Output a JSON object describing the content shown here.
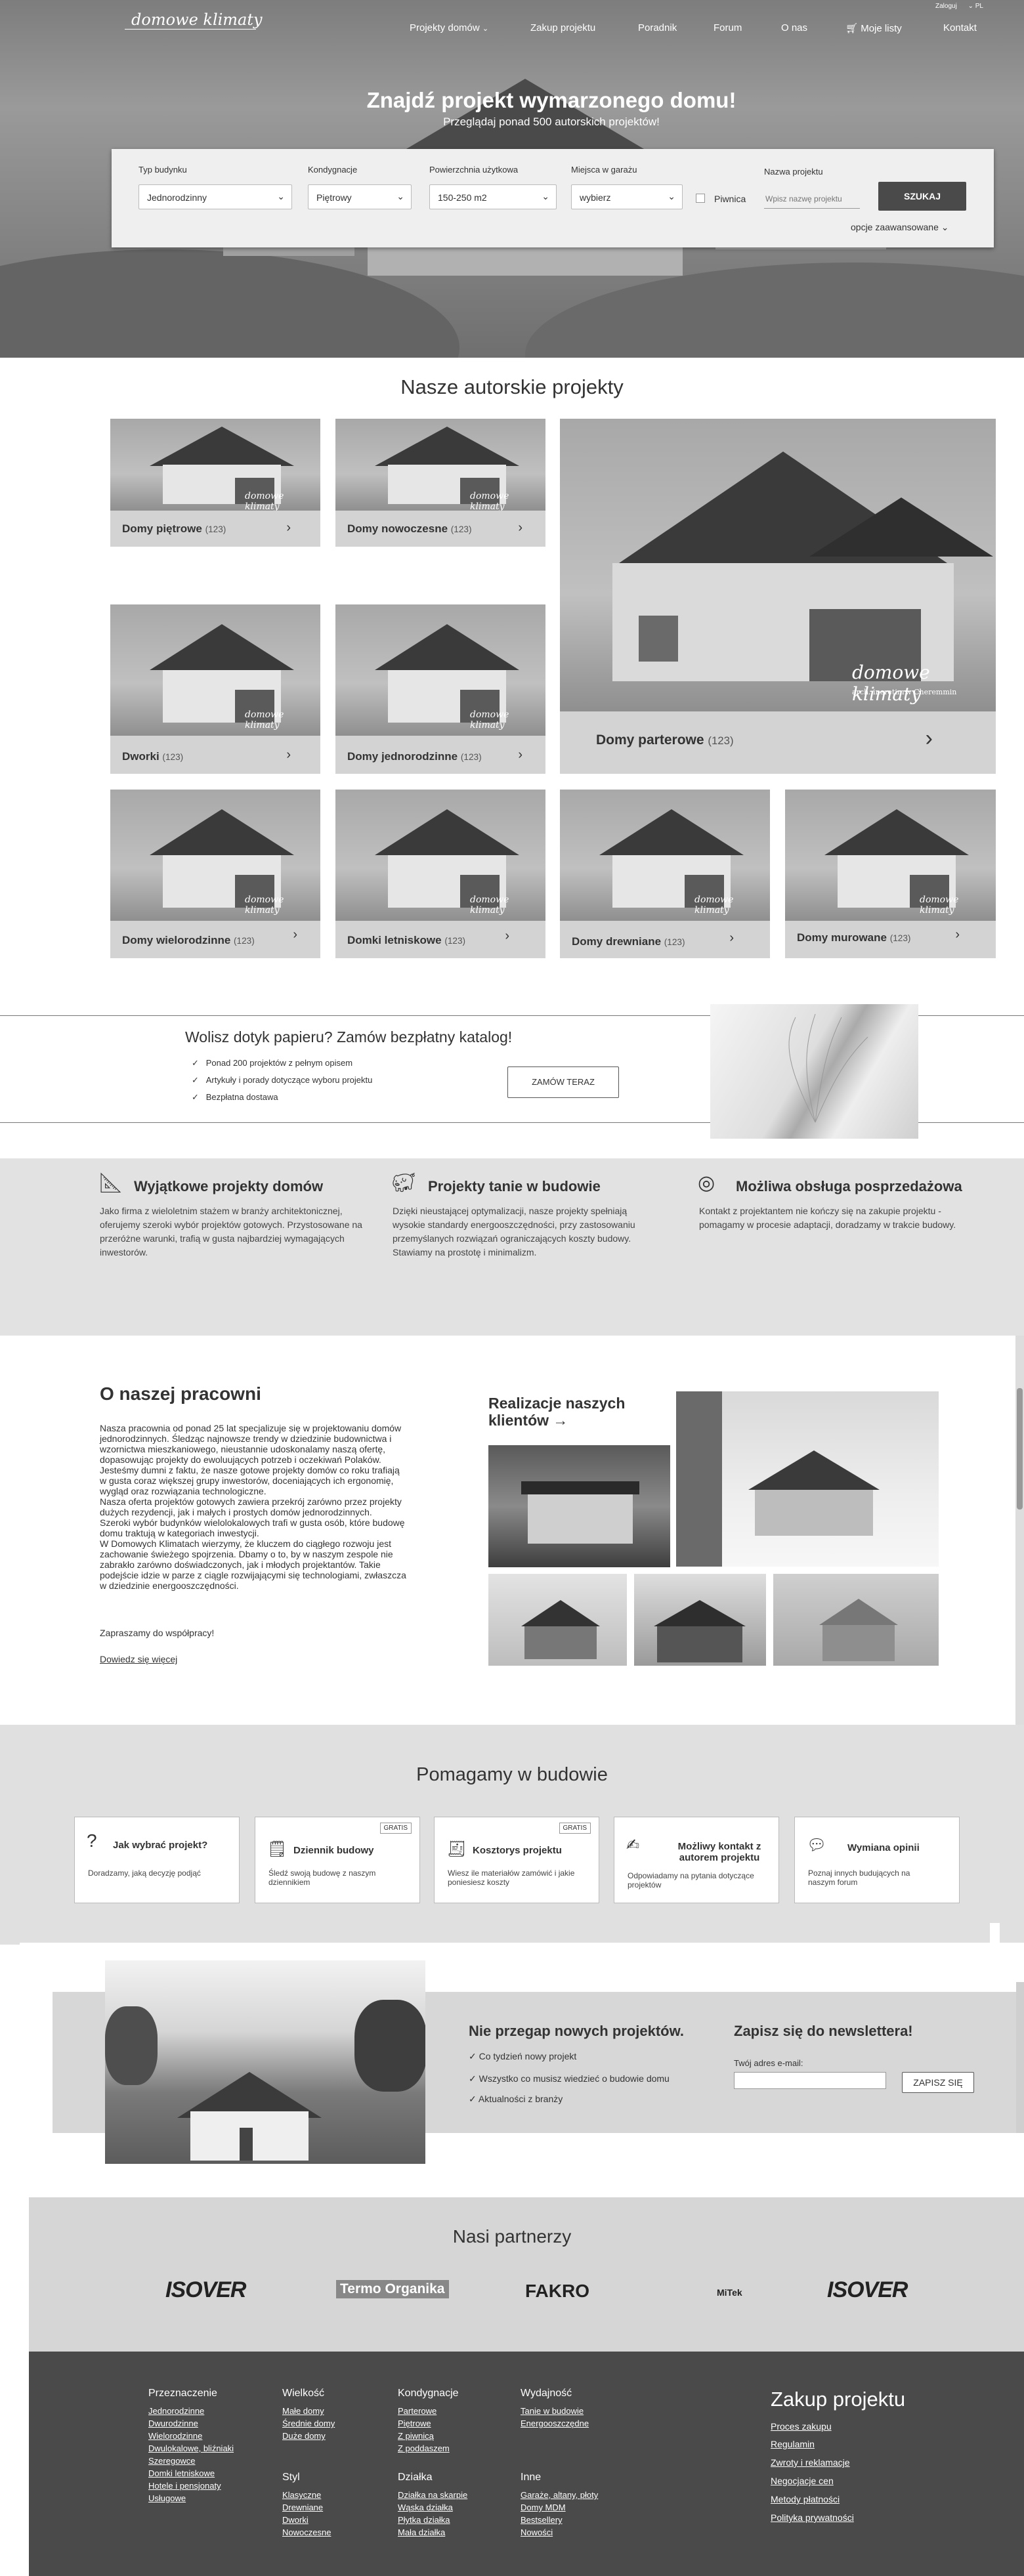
{
  "header": {
    "logo_text": "domowe klimaty",
    "login": "Zaloguj",
    "lang": "PL",
    "nav": [
      "Projekty domów",
      "Zakup projektu",
      "Poradnik",
      "Forum",
      "O nas",
      "Moje listy",
      "Kontakt"
    ]
  },
  "hero": {
    "title": "Znajdź projekt wymarzonego domu!",
    "subtitle": "Przeglądaj ponad 500 autorskich projektów!"
  },
  "search": {
    "building_type_label": "Typ budynku",
    "building_type_value": "Jednorodzinny",
    "floors_label": "Kondygnacje",
    "floors_value": "Piętrowy",
    "area_label": "Powierzchnia użytkowa",
    "area_value": "150-250 m2",
    "garage_label": "Miejsca w garażu",
    "garage_value": "wybierz",
    "basement_label": "Piwnica",
    "name_label": "Nazwa projektu",
    "name_placeholder": "Wpisz nazwę projektu",
    "submit_label": "SZUKAJ",
    "advanced_label": "opcje zaawansowane"
  },
  "projects": {
    "title": "Nasze autorskie projekty",
    "tiles": [
      {
        "label": "Domy piętrowe",
        "count": "(123)"
      },
      {
        "label": "Domy nowoczesne",
        "count": "(123)"
      },
      {
        "label": "Domy parterowe",
        "count": "(123)"
      },
      {
        "label": "Dworki",
        "count": "(123)"
      },
      {
        "label": "Domy jednorodzinne",
        "count": "(123)"
      },
      {
        "label": "Domy wielorodzinne",
        "count": "(123)"
      },
      {
        "label": "Domki letniskowe",
        "count": "(123)"
      },
      {
        "label": "Domy drewniane",
        "count": "(123)"
      },
      {
        "label": "Domy murowane",
        "count": "(123)"
      }
    ],
    "watermark": "domowe klimaty",
    "watermark_sub": "arch. ineretinrw Cheremmin"
  },
  "catalog": {
    "title": "Wolisz dotyk papieru? Zamów bezpłatny katalog!",
    "items": [
      "Ponad 200 projektów z pełnym opisem",
      "Artykuły i porady dotyczące wyboru projektu",
      "Bezpłatna dostawa"
    ],
    "button": "ZAMÓW TERAZ"
  },
  "features": [
    {
      "title": "Wyjątkowe projekty domów",
      "icon": "drafting-icon",
      "text": "Jako firma z wieloletnim stażem w branży architektonicznej, oferujemy szeroki wybór projektów gotowych. Przystosowane na przeróżne warunki, trafią w gusta najbardziej wymagających inwestorów."
    },
    {
      "title": "Projekty tanie w budowie",
      "icon": "piggy-bank-icon",
      "text": "Dzięki nieustającej optymalizacji, nasze projekty spełniają wysokie standardy energooszczędności, przy zastosowaniu przemyślanych rozwiązań ograniczających koszty budowy. Stawiamy na prostotę i minimalizm."
    },
    {
      "title": "Możliwa obsługa posprzedażowa",
      "icon": "lifebuoy-icon",
      "text": "Kontakt z projektantem nie kończy się na zakupie projektu - pomagamy w procesie adaptacji, doradzamy w trakcie budowy."
    }
  ],
  "about": {
    "title": "O naszej pracowni",
    "paragraphs": [
      "Nasza pracownia od ponad 25 lat specjalizuje się w projektowaniu domów",
      "jednorodzinnych. Śledząc najnowsze trendy w dziedzinie budownictwa i",
      "wzornictwa mieszkaniowego, nieustannie udoskonalamy naszą ofertę,",
      "dopasowując projekty do ewoluujących potrzeb i oczekiwań Polaków.",
      "Jesteśmy dumni z faktu, że nasze gotowe projekty domów co roku trafiają",
      "w gusta coraz większej grupy inwestorów, doceniających ich ergonomię,",
      "wygląd oraz rozwiązania technologiczne.",
      "Nasza oferta projektów gotowych zawiera przekrój zarówno przez projekty",
      "dużych rezydencji, jak i małych i prostych domów jednorodzinnych.",
      "Szeroki wybór budynków wielolokalowych trafi w gusta osób, które budowę",
      "domu traktują w kategoriach inwestycji.",
      "W Domowych Klimatach wierzymy, że kluczem do ciągłego rozwoju jest",
      "zachowanie świeżego spojrzenia. Dbamy o to, by w naszym zespole nie",
      "zabrakło zarówno doświadczonych, jak i młodych projektantów. Takie",
      "podejście idzie w parze z ciągle rozwijającymi się technologiami, zwłaszcza",
      "w dziedzinie energooszczędności."
    ],
    "closing": "Zapraszamy do współpracy!",
    "more_link": "Dowiedz się więcej",
    "realizations_title": "Realizacje naszych klientów →"
  },
  "help": {
    "title": "Pomagamy w budowie",
    "cards": [
      {
        "title": "Jak wybrać projekt?",
        "desc": "Doradzamy, jaką decyzję podjąć",
        "badge": "",
        "icon": "question-icon"
      },
      {
        "title": "Dziennik budowy",
        "desc": "Śledź swoją budowę z naszym dziennikiem",
        "badge": "GRATIS",
        "icon": "diary-icon"
      },
      {
        "title": "Kosztorys projektu",
        "desc": "Wiesz ile materiałów zamówić i jakie poniesiesz koszty",
        "badge": "GRATIS",
        "icon": "estimate-icon"
      },
      {
        "title": "Możliwy kontakt z autorem projektu",
        "desc": "Odpowiadamy na pytania dotyczące projektów",
        "badge": "",
        "icon": "contact-icon"
      },
      {
        "title": "Wymiana opinii",
        "desc": "Poznaj innych budujących na naszym forum",
        "badge": "",
        "icon": "chat-icon"
      }
    ]
  },
  "newsletter": {
    "title1": "Nie przegap nowych projektów.",
    "items": [
      "Co tydzień nowy projekt",
      "Wszystko co musisz wiedzieć o budowie domu",
      "Aktualności z branży"
    ],
    "title2": "Zapisz się do newslettera!",
    "email_label": "Twój adres e-mail:",
    "button": "ZAPISZ SIĘ"
  },
  "partners": {
    "title": "Nasi partnerzy",
    "logos": [
      "ISOVER",
      "Termo Organika",
      "FAKRO",
      "MiTek",
      "ISOVER"
    ]
  },
  "footer": {
    "cols": [
      {
        "title": "Przeznaczenie",
        "links": [
          "Jednorodzinne",
          "Dwurodzinne",
          "Wielorodzinne",
          "Dwulokalowe, bliźniaki",
          "Szeregowce",
          "Domki letniskowe",
          "Hotele i pensjonaty",
          "Usługowe"
        ]
      },
      {
        "title": "Wielkość",
        "links": [
          "Małe domy",
          "Średnie domy",
          "Duże domy"
        ]
      },
      {
        "title": "Styl",
        "links": [
          "Klasyczne",
          "Drewniane",
          "Dworki",
          "Nowoczesne"
        ]
      },
      {
        "title": "Kondygnacje",
        "links": [
          "Parterowe",
          "Piętrowe",
          "Z piwnicą",
          "Z poddaszem"
        ]
      },
      {
        "title": "Działka",
        "links": [
          "Działka na skarpie",
          "Wąska działka",
          "Płytka działka",
          "Mała działka"
        ]
      },
      {
        "title": "Wydajność",
        "links": [
          "Tanie w budowie",
          "Energooszczędne"
        ]
      },
      {
        "title": "Inne",
        "links": [
          "Garaże, altany, płoty",
          "Domy MDM",
          "Bestsellery",
          "Nowości"
        ]
      }
    ],
    "purchase_title": "Zakup projektu",
    "purchase_links": [
      "Proces zakupu",
      "Regulamin",
      "Zwroty i reklamacje",
      "Negocjacje cen",
      "Metody płatności",
      "Polityka prywatności"
    ]
  }
}
